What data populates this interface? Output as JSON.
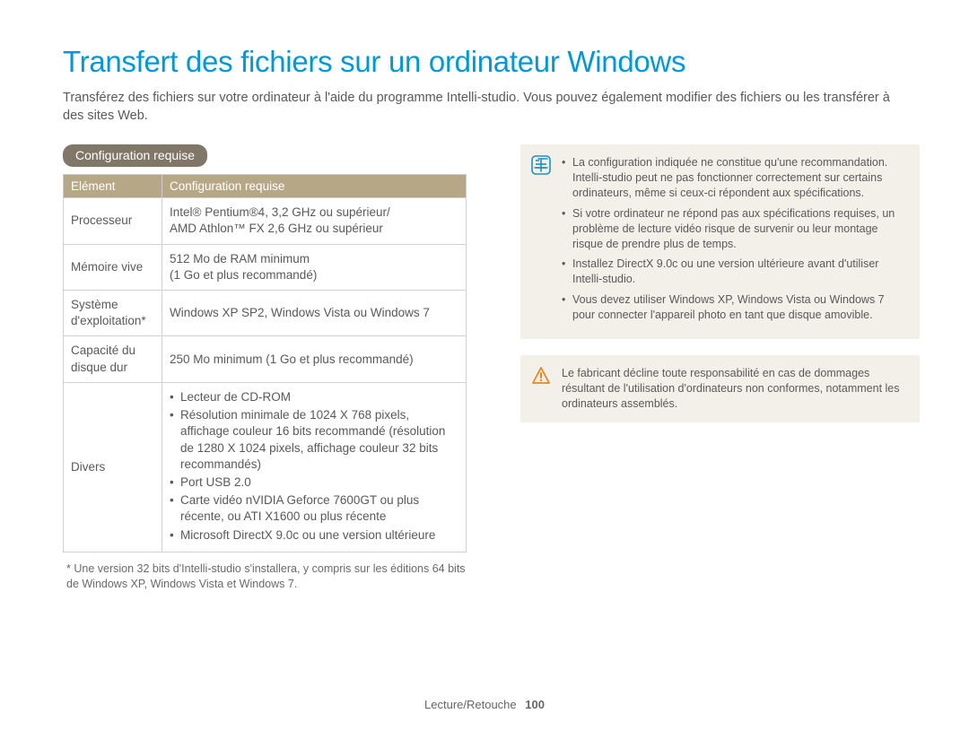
{
  "title": "Transfert des fichiers sur un ordinateur Windows",
  "intro": "Transférez des fichiers sur votre ordinateur à l'aide du programme Intelli-studio. Vous pouvez également modifier des fichiers ou les transférer à des sites Web.",
  "section_heading": "Configuration requise",
  "table": {
    "headers": {
      "element": "Elément",
      "req": "Configuration requise"
    },
    "rows": {
      "cpu": {
        "k": "Processeur",
        "v": "Intel® Pentium®4, 3,2 GHz ou supérieur/\nAMD Athlon™ FX 2,6 GHz ou supérieur"
      },
      "ram": {
        "k": "Mémoire vive",
        "v": "512 Mo de RAM minimum\n(1 Go et plus recommandé)"
      },
      "os": {
        "k": "Système d'exploitation*",
        "v": "Windows XP SP2, Windows Vista ou Windows 7"
      },
      "hdd": {
        "k": "Capacité du disque dur",
        "v": "250 Mo minimum (1 Go et plus recommandé)"
      },
      "misc_k": "Divers",
      "misc": [
        "Lecteur de CD-ROM",
        "Résolution minimale de 1024 X 768 pixels, affichage couleur 16 bits recommandé (résolution de 1280 X 1024 pixels, affichage couleur 32 bits recommandés)",
        "Port USB 2.0",
        "Carte vidéo nVIDIA Geforce 7600GT ou plus récente, ou ATI X1600 ou plus récente",
        "Microsoft DirectX 9.0c ou une version ultérieure"
      ]
    }
  },
  "footnote": "* Une version 32 bits d'Intelli-studio s'installera, y compris sur les éditions 64 bits de Windows XP, Windows Vista et Windows 7.",
  "info_notes": [
    "La configuration indiquée ne constitue qu'une recommandation. Intelli-studio peut ne pas fonctionner correctement sur certains ordinateurs, même si ceux-ci répondent aux spécifications.",
    "Si votre ordinateur ne répond pas aux spécifications requises, un problème de lecture vidéo risque de survenir ou leur montage risque de prendre plus de temps.",
    "Installez DirectX 9.0c ou une version ultérieure avant d'utiliser Intelli-studio.",
    "Vous devez utiliser Windows XP, Windows Vista ou Windows 7 pour connecter l'appareil photo en tant que disque amovible."
  ],
  "warning_text": "Le fabricant décline toute responsabilité en cas de dommages résultant de l'utilisation d'ordinateurs non conformes, notamment les ordinateurs assemblés.",
  "footer": {
    "section": "Lecture/Retouche",
    "page": "100"
  },
  "icons": {
    "info": "info-icon",
    "warn": "warning-icon"
  }
}
